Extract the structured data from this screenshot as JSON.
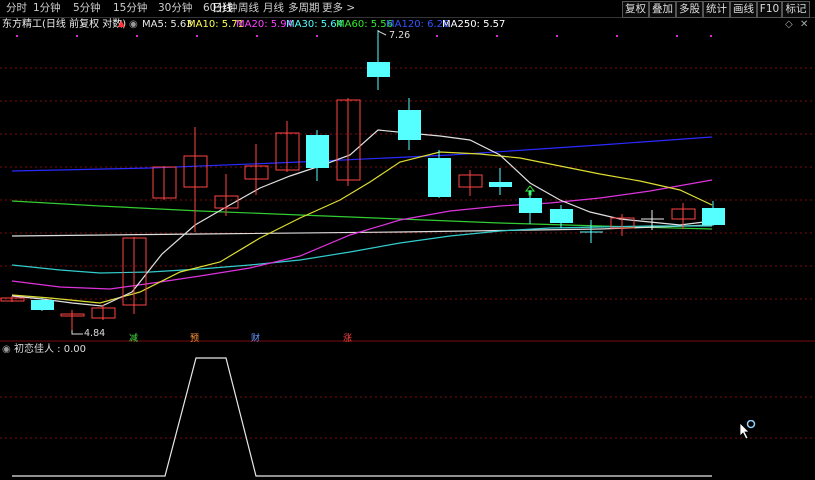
{
  "toolbar": {
    "periods": [
      "分时",
      "1分钟",
      "5分钟",
      "15分钟",
      "30分钟",
      "60分钟",
      "日线",
      "周线",
      "月线",
      "多周期",
      "更多 >"
    ],
    "active_period": "日线",
    "right_buttons": [
      "复权",
      "叠加",
      "多股",
      "统计",
      "画线",
      "F10",
      "标记"
    ]
  },
  "stock": {
    "title": "东方精工(日线 前复权 对数)"
  },
  "ma": {
    "ma5": "MA5: 5.63",
    "ma10": "MA10: 5.71",
    "ma20": "MA20: 5.94",
    "ma30": "MA30: 5.64",
    "ma60": "MA60: 5.56",
    "ma120": "MA120: 6.26",
    "ma250": "MA250: 5.57"
  },
  "colors": {
    "ma5": "#e8e8e8",
    "ma10": "#ffff55",
    "ma20": "#ff44ff",
    "ma30": "#55ffff",
    "ma60": "#33ee33",
    "ma120": "#3333ff",
    "ma250": "#ffffff",
    "up": "#ff4444",
    "down": "#55ffff",
    "grid": "#7a0b0b"
  },
  "annotations": {
    "high_price": "7.26",
    "low_price": "4.84",
    "marks": [
      "减",
      "预",
      "财",
      "涨"
    ]
  },
  "indicator": {
    "label": "初恋佳人 : 0.00"
  }
}
